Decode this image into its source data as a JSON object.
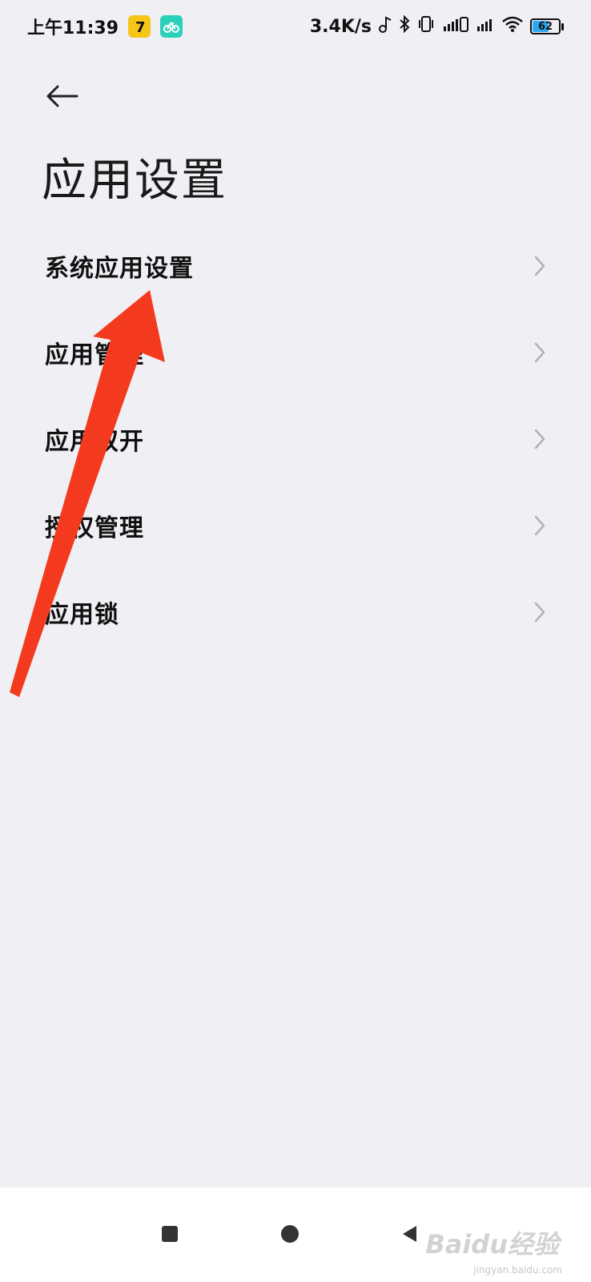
{
  "status_bar": {
    "time": "上午11:39",
    "net_speed": "3.4K/s",
    "battery_level": "62",
    "icons": [
      "seven-app-icon",
      "bike-app-icon",
      "music-icon",
      "bluetooth-icon",
      "vibrate-icon",
      "signal-icon",
      "signal-icon",
      "wifi-icon",
      "battery-icon"
    ]
  },
  "header": {
    "back_icon": "arrow-left-icon",
    "title": "应用设置"
  },
  "settings": {
    "items": [
      {
        "label": "系统应用设置"
      },
      {
        "label": "应用管理"
      },
      {
        "label": "应用双开"
      },
      {
        "label": "授权管理"
      },
      {
        "label": "应用锁"
      }
    ]
  },
  "annotation": {
    "color": "#f43a1e"
  },
  "nav_bar": {
    "buttons": [
      "recent-apps-icon",
      "home-icon",
      "back-triangle-icon"
    ]
  },
  "watermark": {
    "text": "Baidu经验",
    "sub": "jingyan.baidu.com"
  }
}
